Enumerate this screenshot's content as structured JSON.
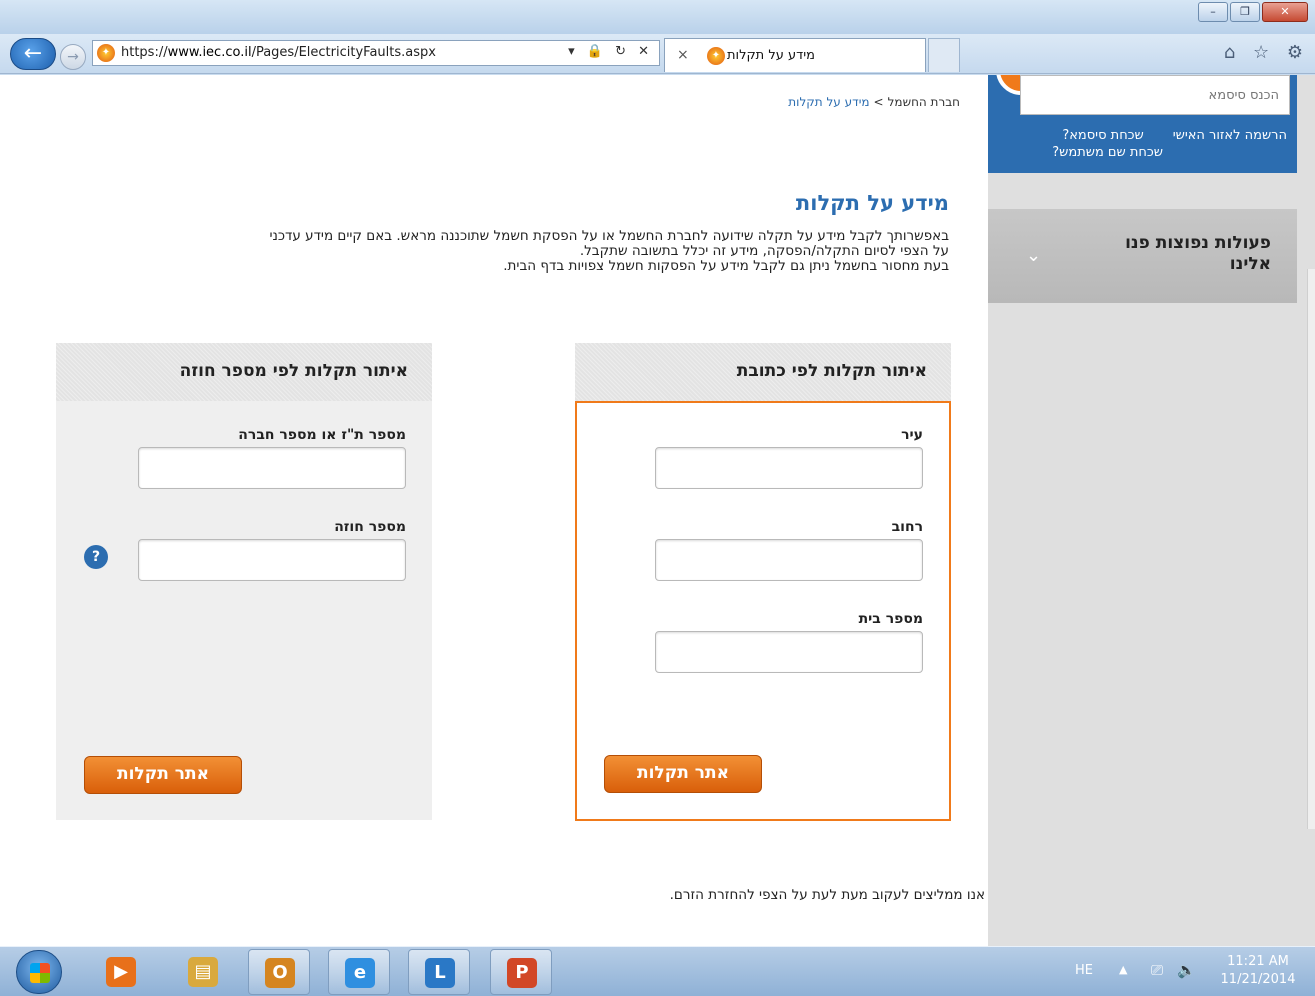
{
  "browser": {
    "url_prefix": "https://",
    "url_domain": "www.iec.co.il",
    "url_path": "/Pages/ElectricityFaults.aspx",
    "address_controls": "▾ 🔒 ↻ ✕",
    "tab_title": "מידע על תקלות",
    "tab_close": "×",
    "tools": "⌂ ☆ ⚙",
    "win_minimize": "–",
    "win_restore": "❐",
    "win_close": "✕",
    "back": "←",
    "forward": "→",
    "site_icon": "iec-logo-icon"
  },
  "sidebar": {
    "password_placeholder": "הכנס סיסמא",
    "links": {
      "register": "הרשמה לאזור האישי",
      "forgot_password": "שכחת סיסמא?",
      "forgot_username": "שכחת שם משתמש?"
    },
    "actions_title": "פעולות נפוצות פנו אלינו",
    "actions_chevron": "⌄"
  },
  "breadcrumb": {
    "home": "חברת החשמל",
    "separator": ">",
    "current": "מידע על תקלות"
  },
  "page": {
    "title": "מידע על תקלות",
    "intro": [
      "באפשרותך לקבל מידע על תקלה שידועה לחברת החשמל או על הפסקת חשמל שתוכננה מראש. באם קיים מידע עדכני",
      "על הצפי לסיום התקלה/הפסקה, מידע זה יכלל בתשובה שתקבל.",
      "בעת מחסור בחשמל ניתן גם לקבל מידע על הפסקות חשמל צפויות בדף הבית."
    ],
    "recommendation": "אנו ממליצים לעקוב מעת לעת על הצפי להחזרת הזרם."
  },
  "address_search": {
    "title": "איתור תקלות לפי כתובת",
    "city_label": "עיר",
    "city_value": "",
    "street_label": "רחוב",
    "street_value": "",
    "house_label": "מספר בית",
    "house_value": "",
    "button": "אתר תקלות"
  },
  "contract_search": {
    "title": "איתור תקלות לפי מספר חוזה",
    "id_label": "מספר ת\"ז או מספר חברה",
    "id_value": "",
    "contract_label": "מספר חוזה",
    "contract_value": "",
    "help": "?",
    "button": "אתר תקלות"
  },
  "taskbar": {
    "apps": [
      {
        "name": "media-player-icon",
        "glyph": "▶",
        "color": "#e8701a"
      },
      {
        "name": "file-explorer-icon",
        "glyph": "▤",
        "color": "#d9a93d"
      },
      {
        "name": "outlook-icon",
        "glyph": "O",
        "color": "#d58520"
      },
      {
        "name": "internet-explorer-icon",
        "glyph": "e",
        "color": "#2f8fe0"
      },
      {
        "name": "lync-icon",
        "glyph": "L",
        "color": "#2a78c6"
      },
      {
        "name": "powerpoint-icon",
        "glyph": "P",
        "color": "#d24726"
      }
    ],
    "language": "HE",
    "tray_arrow": "▲",
    "network_icon": "⎚",
    "volume_icon": "🔈",
    "time": "11:21 AM",
    "date": "11/21/2014"
  },
  "colors": {
    "brand_blue": "#2c6db0",
    "brand_orange": "#f07a1a"
  }
}
